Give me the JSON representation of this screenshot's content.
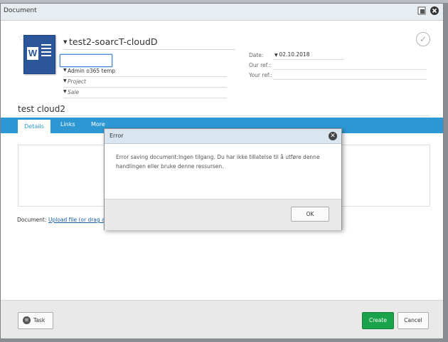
{
  "window": {
    "title": "Document"
  },
  "document": {
    "title": "test2-soarcT-cloudD",
    "fields": [
      "Admin o365 temp",
      "Project",
      "Sale"
    ],
    "heading": "test cloud2"
  },
  "meta": {
    "date_label": "Date:",
    "date_value": "02.10.2018",
    "our_ref_label": "Our ref.:",
    "your_ref_label": "Your ref.:"
  },
  "tabs": [
    "Details",
    "Links",
    "More"
  ],
  "upload": {
    "label": "Document:",
    "link": "Upload file (or drag ar"
  },
  "footer": {
    "task": "Task",
    "create": "Create",
    "cancel": "Cancel"
  },
  "error_dialog": {
    "title": "Error",
    "message": "Error saving document:Ingen tilgang. Du har ikke tillatelse til å utføre denne handlingen eller bruke denne ressursen.",
    "ok": "OK"
  },
  "colors": {
    "tabbar": "#2d98d4",
    "create": "#1aa34a",
    "word": "#2b579a"
  },
  "icons": [
    "star-icon",
    "word-document-icon",
    "checkmark-circle-icon",
    "restore-icon",
    "close-icon",
    "task-icon"
  ]
}
